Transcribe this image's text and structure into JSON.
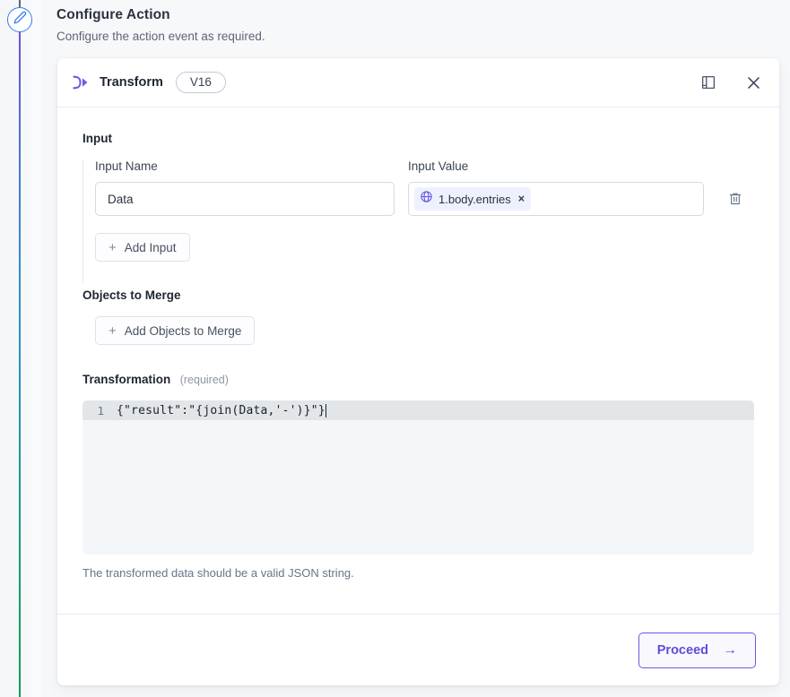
{
  "page": {
    "title": "Configure Action",
    "subtitle": "Configure the action event as required."
  },
  "rail": {
    "node_icon": "pencil-edit-icon"
  },
  "panel": {
    "icon": "transform-icon",
    "title": "Transform",
    "version_badge": "V16",
    "header_actions": [
      {
        "name": "book-panel-icon",
        "label": ""
      },
      {
        "name": "close-icon",
        "label": ""
      }
    ]
  },
  "input_section": {
    "heading": "Input",
    "name_label": "Input Name",
    "value_label": "Input Value",
    "name_value": "Data",
    "name_placeholder": "Input Name",
    "chip": {
      "icon": "globe-icon",
      "text": "1.body.entries",
      "remove": "×"
    },
    "delete_icon": "trash-icon",
    "add_input_label": "Add Input",
    "add_input_plus": "+"
  },
  "objects_section": {
    "heading": "Objects to Merge",
    "add_label": "Add Objects to Merge",
    "add_plus": "+"
  },
  "transformation_section": {
    "heading": "Transformation",
    "required_tag": "(required)",
    "line_number": "1",
    "code": "{\"result\":\"{join(Data,'-')}\"}",
    "help_text": "The transformed data should be a valid JSON string."
  },
  "footer": {
    "proceed_label": "Proceed",
    "proceed_arrow": "→"
  },
  "colors": {
    "accent_purple": "#6a5ae0",
    "node_blue": "#2f7ded",
    "chip_bg": "#eef1fd",
    "editor_bg": "#f4f7fa",
    "active_line": "#e3e6e8"
  }
}
